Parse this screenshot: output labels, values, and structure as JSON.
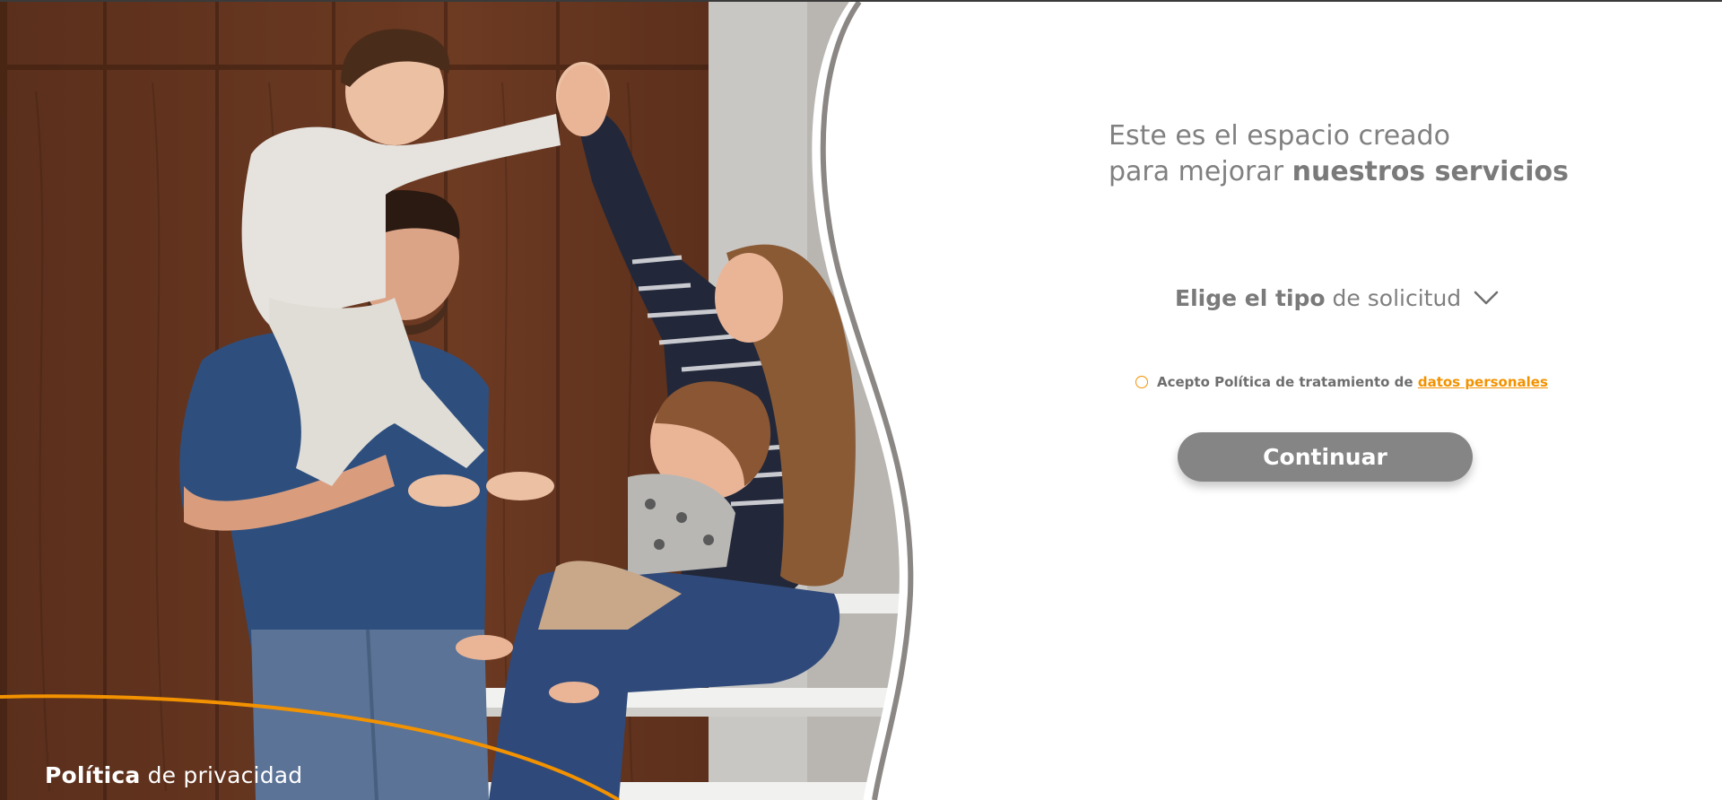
{
  "headline": {
    "line1": "Este es el espacio creado",
    "line2_prefix": "para mejorar ",
    "line2_bold": "nuestros servicios"
  },
  "request_type": {
    "bold_label": "Elige el tipo",
    "label_rest": "de solicitud",
    "icon": "chevron-down-icon"
  },
  "consent": {
    "text": "Acepto Política de tratamiento de",
    "link_text": "datos personales"
  },
  "continue_button": {
    "label": "Continuar"
  },
  "footer": {
    "privacy_bold": "Política",
    "privacy_rest": "de privacidad"
  },
  "colors": {
    "accent": "#f39200",
    "text_gray": "#808080",
    "button_gray": "#858585",
    "background": "#ffffff"
  }
}
